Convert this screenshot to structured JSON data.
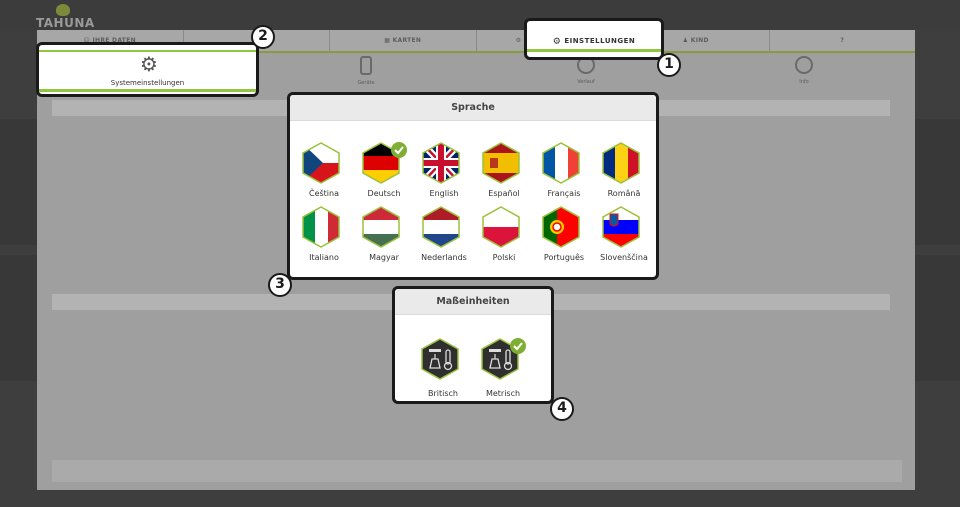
{
  "app": {
    "logo": "TAHUNA"
  },
  "tabs": [
    {
      "label": "☺ IHRE DATEN"
    },
    {
      "label": ""
    },
    {
      "label": "▦ KARTEN"
    },
    {
      "label": "⚙ EINSTELLUNGEN"
    },
    {
      "label": "♟ KIND"
    },
    {
      "label": "?"
    }
  ],
  "settings_tab": {
    "label": "EINSTELLUNGEN"
  },
  "sub_items": [
    {
      "label": "Systemeinstellungen",
      "icon": "gear-icon"
    },
    {
      "label": "Geräte",
      "icon": "phone-icon"
    },
    {
      "label": "Verlauf",
      "icon": "history-icon"
    },
    {
      "label": "Info",
      "icon": "info-icon"
    }
  ],
  "language": {
    "title": "Sprache",
    "selected": "Deutsch",
    "items": [
      {
        "label": "Čeština",
        "flag": "cz"
      },
      {
        "label": "Deutsch",
        "flag": "de"
      },
      {
        "label": "English",
        "flag": "gb"
      },
      {
        "label": "Español",
        "flag": "es"
      },
      {
        "label": "Français",
        "flag": "fr"
      },
      {
        "label": "Română",
        "flag": "ro"
      },
      {
        "label": "Italiano",
        "flag": "it"
      },
      {
        "label": "Magyar",
        "flag": "hu"
      },
      {
        "label": "Nederlands",
        "flag": "nl"
      },
      {
        "label": "Polski",
        "flag": "pl"
      },
      {
        "label": "Português",
        "flag": "pt"
      },
      {
        "label": "Slovenščina",
        "flag": "si"
      }
    ]
  },
  "units": {
    "title": "Maßeinheiten",
    "selected": "Metrisch",
    "items": [
      {
        "label": "Britisch",
        "icon": "imperial-units-icon"
      },
      {
        "label": "Metrisch",
        "icon": "metric-units-icon"
      }
    ]
  },
  "badges": [
    "1",
    "2",
    "3",
    "4"
  ],
  "colors": {
    "accent_green": "#8fc740",
    "check_green": "#7fae34",
    "hex_border": "#9bc23b",
    "overlay": "#9f9f9f"
  }
}
